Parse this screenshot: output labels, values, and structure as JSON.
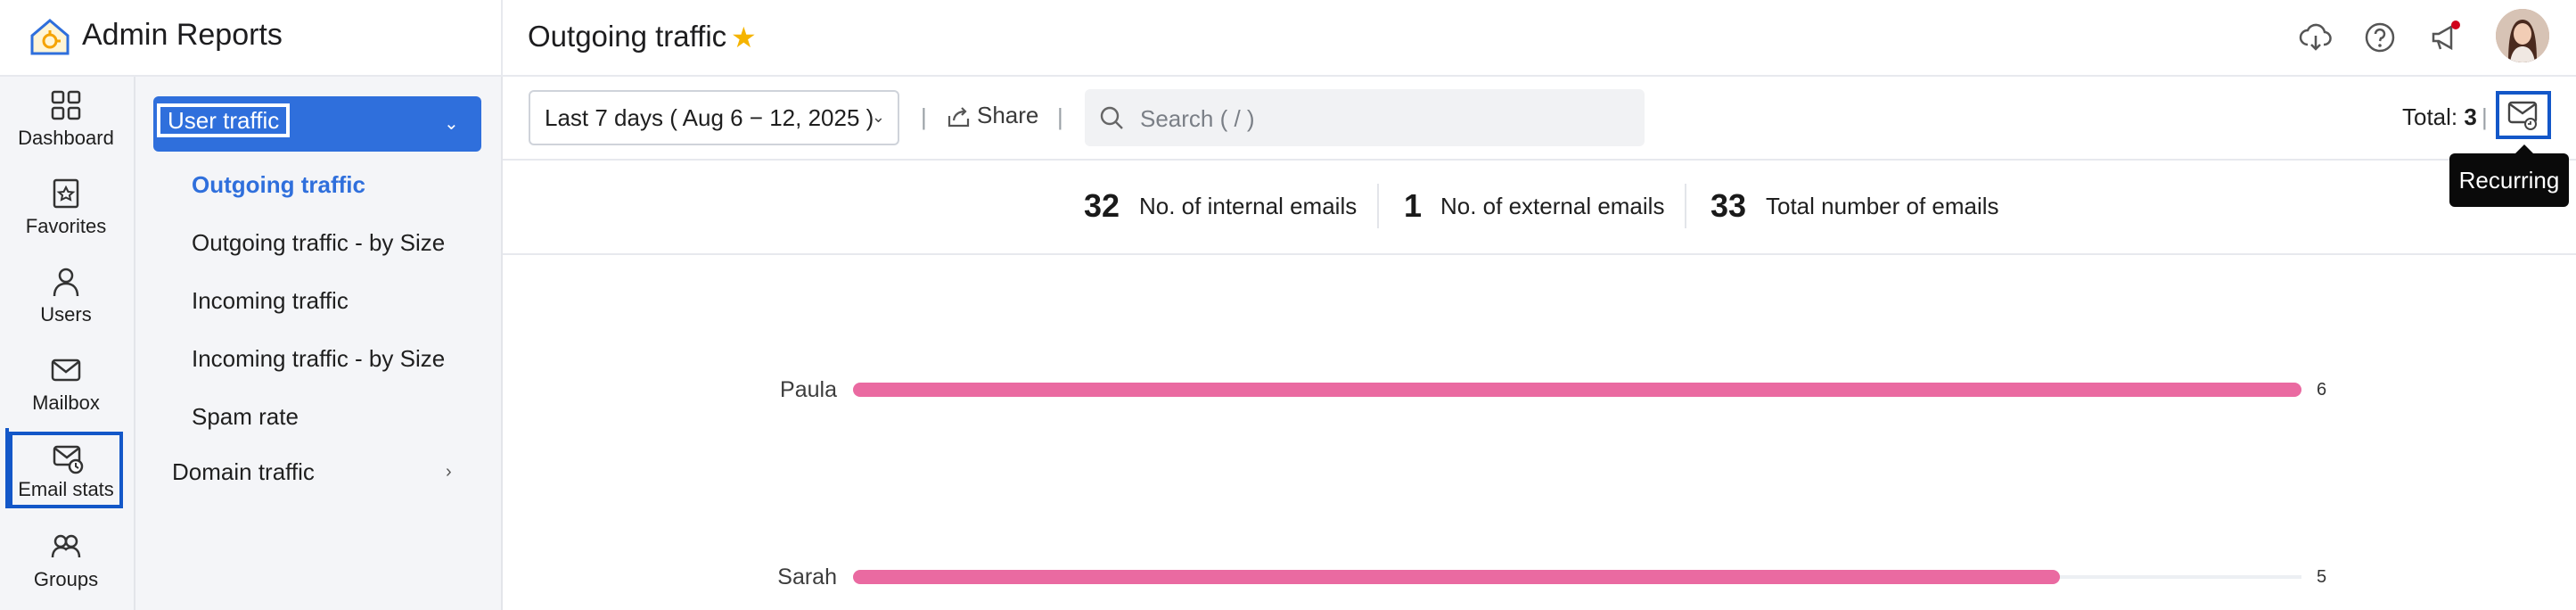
{
  "app": {
    "title": "Admin Reports"
  },
  "page": {
    "title": "Outgoing traffic"
  },
  "rail": [
    {
      "label": "Dashboard",
      "icon": "dashboard-icon"
    },
    {
      "label": "Favorites",
      "icon": "favorites-icon"
    },
    {
      "label": "Users",
      "icon": "user-icon"
    },
    {
      "label": "Mailbox",
      "icon": "mailbox-icon"
    },
    {
      "label": "Email stats",
      "icon": "email-stats-icon",
      "active": true
    },
    {
      "label": "Groups",
      "icon": "groups-icon"
    }
  ],
  "subnav": {
    "group": "User traffic",
    "items": [
      "Outgoing traffic",
      "Outgoing traffic - by Size",
      "Incoming traffic",
      "Incoming traffic - by Size",
      "Spam rate"
    ],
    "active_item": "Outgoing traffic",
    "group2": "Domain traffic"
  },
  "toolbar": {
    "date_range": "Last 7 days ( Aug 6 − 12, 2025 )",
    "separator": "|",
    "share": "Share",
    "search_placeholder": "Search ( / )",
    "total_label": "Total:",
    "total_value": "3",
    "tooltip": "Recurring"
  },
  "stats": [
    {
      "value": "32",
      "label": "No. of internal emails"
    },
    {
      "value": "1",
      "label": "No. of external emails"
    },
    {
      "value": "33",
      "label": "Total number of emails"
    }
  ],
  "chart_data": {
    "type": "bar",
    "orientation": "horizontal",
    "categories": [
      "Paula",
      "Sarah"
    ],
    "values": [
      6,
      5
    ],
    "xlim": [
      0,
      6
    ],
    "color": "#ea6aa1"
  },
  "colors": {
    "accent": "#2f6fdc",
    "highlight": "#1357c8",
    "bar": "#ea6aa1",
    "star": "#f5b400",
    "notification": "#d0021b"
  }
}
